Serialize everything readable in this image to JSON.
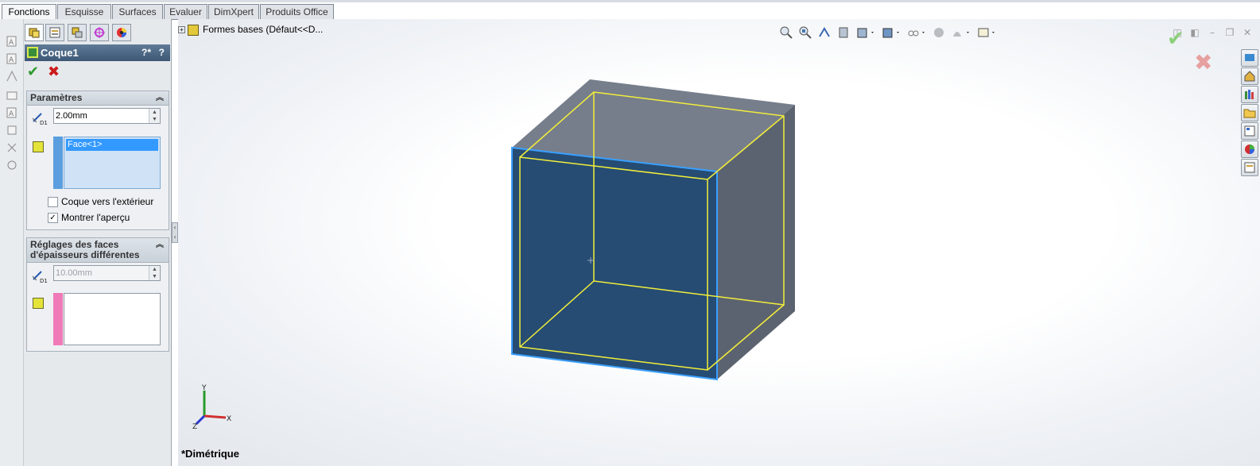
{
  "tabs": [
    {
      "label": "Fonctions",
      "active": true
    },
    {
      "label": "Esquisse",
      "active": false
    },
    {
      "label": "Surfaces",
      "active": false
    },
    {
      "label": "Evaluer",
      "active": false
    },
    {
      "label": "DimXpert",
      "active": false
    },
    {
      "label": "Produits Office",
      "active": false
    }
  ],
  "property_manager": {
    "title": "Coque1",
    "help_icon": "?*",
    "help": "?",
    "ok": "✔",
    "cancel": "✖",
    "parametres": {
      "heading": "Paramètres",
      "thickness": "2.00mm",
      "faces_selected": [
        "Face<1>"
      ],
      "checkbox_outward": {
        "label": "Coque vers l'extérieur",
        "checked": false
      },
      "checkbox_preview": {
        "label": "Montrer l'aperçu",
        "checked": true
      }
    },
    "multi_thickness": {
      "heading_line1": "Réglages des faces",
      "heading_line2": "d'épaisseurs différentes",
      "thickness": "10.00mm",
      "faces_selected": []
    }
  },
  "tree": {
    "root_label": "Formes bases  (Défaut<<D..."
  },
  "view": {
    "name": "*Dimétrique",
    "triad_x": "X",
    "triad_y": "Y",
    "triad_z": "Z"
  },
  "colors": {
    "selected_face": "#264c73",
    "edge_highlight": "#3aa0ff",
    "preview_outline": "#f2ee3a",
    "top_face": "#6e7786",
    "right_face": "#5c6370"
  },
  "icons": {
    "hud": [
      "zoom-to-fit-icon",
      "zoom-area-icon",
      "previous-view-icon",
      "section-view-icon",
      "view-orientation-icon",
      "display-style-icon",
      "hide-show-icon",
      "appearance-icon",
      "scene-icon",
      "view-settings-icon"
    ],
    "taskpane": [
      "resources-icon",
      "home-icon",
      "design-library-icon",
      "file-explorer-icon",
      "view-palette-icon",
      "appearances-icon",
      "custom-properties-icon"
    ]
  }
}
